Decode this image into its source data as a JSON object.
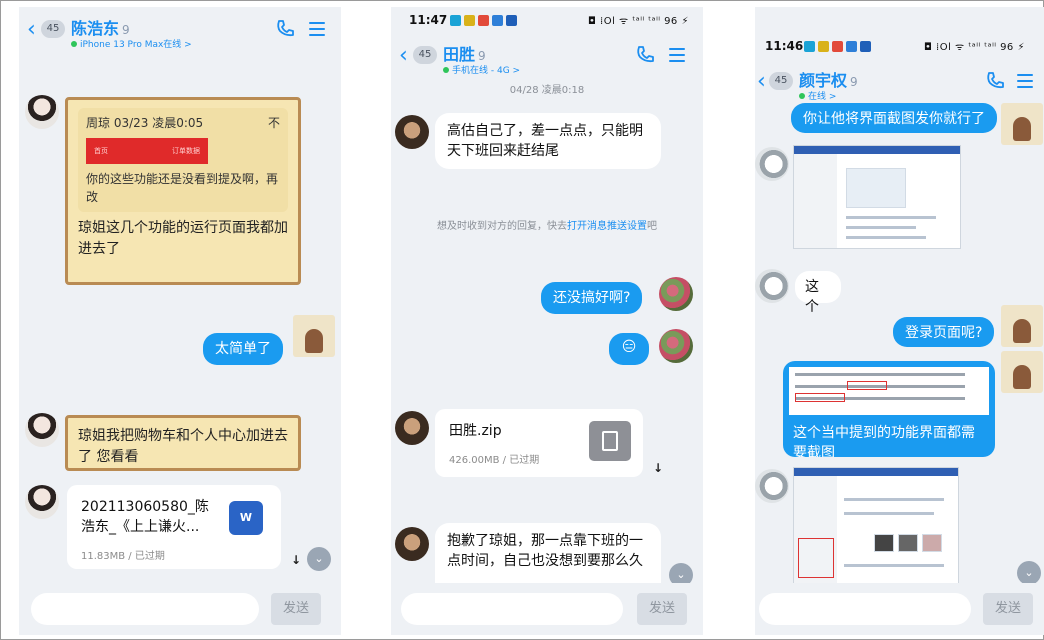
{
  "colors": {
    "accent": "#1b8ef0",
    "bubble_out": "#1a9bf0",
    "scroll_border": "#b98b53",
    "scroll_fill": "#f6e6b3"
  },
  "panel1": {
    "back_badge": "45",
    "title": "陈浩东",
    "signature_icon": "9",
    "status": "iPhone 13 Pro Max在线 >",
    "messages": {
      "quote_header": "周琼 03/23 凌晨0:05",
      "quote_close": "不",
      "quote_bar_left": "首页",
      "quote_bar_right": "订单数据",
      "quote_text": "你的这些功能还是没看到提及啊，再改",
      "reply_text": "琼姐这几个功能的运行页面我都加进去了",
      "out_text": "太简单了",
      "scroll2_text": "琼姐我把购物车和个人中心加进去了 您看看",
      "file_name": "202113060580_陈浩东_《上上谦火...",
      "file_meta": "11.83MB / 已过期",
      "file_icon_label": "W"
    },
    "send_label": "发送"
  },
  "panel2": {
    "time": "11:47",
    "status_right": "◘ ⁞Ol ᯤ ᵗᵃˡˡ ᵗᵃˡˡ 96 ⚡",
    "back_badge": "45",
    "title": "田胜",
    "signature_icon": "9",
    "status": "手机在线 - 4G >",
    "top_time": "04/28 凌晨0:18",
    "messages": {
      "in1": "高估自己了，差一点点，只能明天下班回来赶结尾",
      "system_prefix": "想及时收到对方的回复，快去",
      "system_link": "打开消息推送设置",
      "system_suffix": "吧",
      "out1": "还没搞好啊?",
      "out2_emoji": "😑",
      "file_name": "田胜.zip",
      "file_meta": "426.00MB / 已过期",
      "in2": "抱歉了琼姐，那一点靠下班的一点时间，自己也没想到要那么久"
    },
    "send_label": "发送"
  },
  "panel3": {
    "time": "11:46",
    "status_right": "◘ ⁞Ol ᯤ ᵗᵃˡˡ ᵗᵃˡˡ 96 ⚡",
    "back_badge": "45",
    "title": "颜宇权",
    "signature_icon": "9",
    "status": "在线 >",
    "messages": {
      "out1": "你让他将界面截图发你就行了",
      "in_small": "这个",
      "out2": "登录页面呢?",
      "doc_text": "这个当中提到的功能界面都需要截图"
    },
    "send_label": "发送"
  }
}
